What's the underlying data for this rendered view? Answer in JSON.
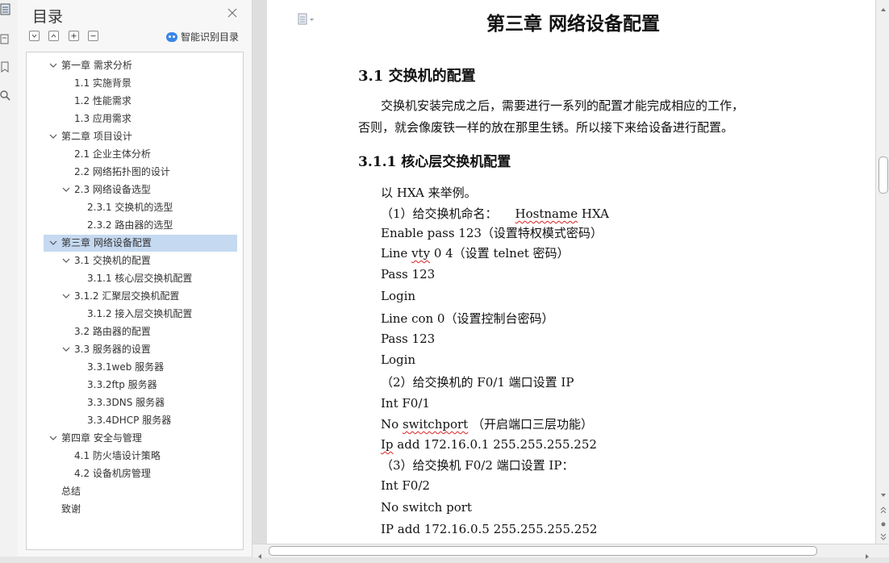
{
  "toc": {
    "title": "目录",
    "smart_label": "智能识别目录",
    "items": [
      {
        "label": "第一章 需求分析"
      },
      {
        "label": "1.1 实施背景"
      },
      {
        "label": "1.2 性能需求"
      },
      {
        "label": "1.3 应用需求"
      },
      {
        "label": "第二章 项目设计"
      },
      {
        "label": "2.1 企业主体分析"
      },
      {
        "label": "2.2 网络拓扑图的设计"
      },
      {
        "label": "2.3 网络设备选型"
      },
      {
        "label": "2.3.1 交换机的选型"
      },
      {
        "label": "2.3.2 路由器的选型"
      },
      {
        "label": "第三章 网络设备配置"
      },
      {
        "label": "3.1 交换机的配置"
      },
      {
        "label": "3.1.1 核心层交换机配置"
      },
      {
        "label": "3.1.2 汇聚层交换机配置"
      },
      {
        "label": "3.1.2 接入层交换机配置"
      },
      {
        "label": "3.2 路由器的配置"
      },
      {
        "label": "3.3 服务器的设置"
      },
      {
        "label": "3.3.1web 服务器"
      },
      {
        "label": "3.3.2ftp 服务器"
      },
      {
        "label": "3.3.3DNS 服务器"
      },
      {
        "label": "3.3.4DHCP 服务器"
      },
      {
        "label": "第四章 安全与管理"
      },
      {
        "label": "4.1 防火墙设计策略"
      },
      {
        "label": "4.2 设备机房管理"
      },
      {
        "label": "总结"
      },
      {
        "label": "致谢"
      }
    ]
  },
  "document": {
    "chapter_title": "第三章  网络设备配置",
    "section_title": "3.1 交换机的配置",
    "para_line1": "交换机安装完成之后，需要进行一系列的配置才能完成相应的工作，",
    "para_line2": "否则，就会像废铁一样的放在那里生锈。所以接下来给设备进行配置。",
    "subsection_title": "3.1.1 核心层交换机配置",
    "lines": {
      "l1": "以 HXA 来举例。",
      "l2a": "（1）给交换机命名：",
      "l2b": "Hostname",
      "l2c": " HXA",
      "l3": "Enable pass 123（设置特权模式密码）",
      "l4a": "Line ",
      "l4b": "vty",
      "l4c": " 0 4（设置 telnet 密码）",
      "l5": "Pass 123",
      "l6": "Login",
      "l7": "Line con 0（设置控制台密码）",
      "l8": "Pass 123",
      "l9": "Login",
      "l10": "（2）给交换机的 F0/1 端口设置 IP",
      "l11": "Int F0/1",
      "l12a": "No ",
      "l12b": "switchport",
      "l12c": " （开启端口三层功能）",
      "l13a": "Ip",
      "l13b": " add 172.16.0.1   255.255.255.252",
      "l14": "（3）给交换机  F0/2 端口设置 IP：",
      "l15": "Int F0/2",
      "l16": "No switch  port",
      "l17": "IP add 172.16.0.5  255.255.255.252"
    }
  },
  "colors": {
    "selection": "#c5d9f1",
    "accent": "#3a86e8",
    "spellcheck": "#dd2222"
  }
}
